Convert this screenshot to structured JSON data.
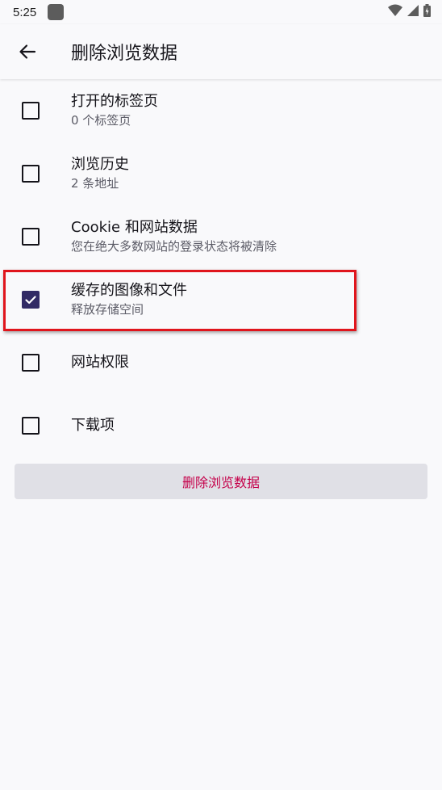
{
  "status_bar": {
    "time": "5:25"
  },
  "app_bar": {
    "title": "删除浏览数据"
  },
  "items": [
    {
      "title": "打开的标签页",
      "subtitle": "0 个标签页",
      "checked": false
    },
    {
      "title": "浏览历史",
      "subtitle": "2 条地址",
      "checked": false
    },
    {
      "title": "Cookie 和网站数据",
      "subtitle": "您在绝大多数网站的登录状态将被清除",
      "checked": false
    },
    {
      "title": "缓存的图像和文件",
      "subtitle": "释放存储空间",
      "checked": true
    },
    {
      "title": "网站权限",
      "subtitle": "",
      "checked": false
    },
    {
      "title": "下载项",
      "subtitle": "",
      "checked": false
    }
  ],
  "delete_button": {
    "label": "删除浏览数据"
  },
  "colors": {
    "accent": "#312a65",
    "danger": "#c5004a",
    "highlight": "#e0151c"
  }
}
